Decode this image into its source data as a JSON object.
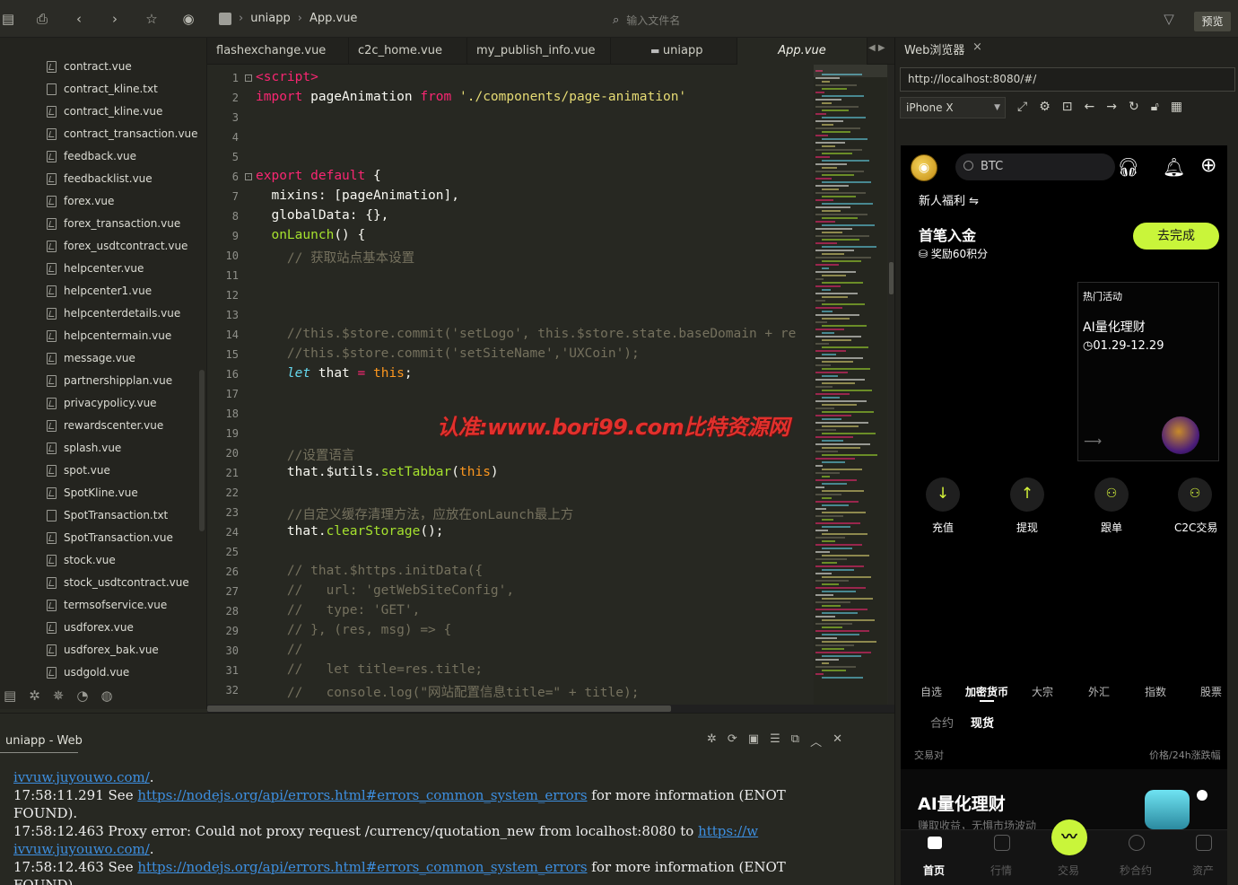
{
  "toolbar": {
    "breadcrumb": [
      "uniapp",
      "App.vue"
    ],
    "file_search_placeholder": "输入文件名",
    "preview_label": "预览",
    "icons": [
      "sidebar-toggle-icon",
      "save-icon",
      "back-arrow-icon",
      "forward-arrow-icon",
      "star-icon",
      "run-icon",
      "filter-icon"
    ]
  },
  "sidebar": {
    "files": [
      {
        "name": "contract.vue",
        "type": "vue"
      },
      {
        "name": "contract_kline.txt",
        "type": "txt"
      },
      {
        "name": "contract_kline.vue",
        "type": "vue"
      },
      {
        "name": "contract_transaction.vue",
        "type": "vue"
      },
      {
        "name": "feedback.vue",
        "type": "vue"
      },
      {
        "name": "feedbacklist.vue",
        "type": "vue"
      },
      {
        "name": "forex.vue",
        "type": "vue"
      },
      {
        "name": "forex_transaction.vue",
        "type": "vue"
      },
      {
        "name": "forex_usdtcontract.vue",
        "type": "vue"
      },
      {
        "name": "helpcenter.vue",
        "type": "vue"
      },
      {
        "name": "helpcenter1.vue",
        "type": "vue"
      },
      {
        "name": "helpcenterdetails.vue",
        "type": "vue"
      },
      {
        "name": "helpcentermain.vue",
        "type": "vue"
      },
      {
        "name": "message.vue",
        "type": "vue"
      },
      {
        "name": "partnershipplan.vue",
        "type": "vue"
      },
      {
        "name": "privacypolicy.vue",
        "type": "vue"
      },
      {
        "name": "rewardscenter.vue",
        "type": "vue"
      },
      {
        "name": "splash.vue",
        "type": "vue"
      },
      {
        "name": "spot.vue",
        "type": "vue"
      },
      {
        "name": "SpotKline.vue",
        "type": "vue"
      },
      {
        "name": "SpotTransaction.txt",
        "type": "txt"
      },
      {
        "name": "SpotTransaction.vue",
        "type": "vue"
      },
      {
        "name": "stock.vue",
        "type": "vue"
      },
      {
        "name": "stock_usdtcontract.vue",
        "type": "vue"
      },
      {
        "name": "termsofservice.vue",
        "type": "vue"
      },
      {
        "name": "usdforex.vue",
        "type": "vue"
      },
      {
        "name": "usdforex_bak.vue",
        "type": "vue"
      },
      {
        "name": "usdgold.vue",
        "type": "vue"
      }
    ]
  },
  "tabs": [
    {
      "label": "flashexchange.vue",
      "active": false
    },
    {
      "label": "c2c_home.vue",
      "active": false
    },
    {
      "label": "my_publish_info.vue",
      "active": false
    },
    {
      "label": "uniapp",
      "active": false,
      "folder": true
    },
    {
      "label": "App.vue",
      "active": true
    }
  ],
  "editor": {
    "lines": [
      {
        "n": "1",
        "fold": "⊟",
        "code": [
          [
            "kw",
            "<script>"
          ]
        ]
      },
      {
        "n": "2",
        "code": [
          [
            "kw",
            "import"
          ],
          [
            "pr",
            " pageAnimation "
          ],
          [
            "kw",
            "from"
          ],
          [
            "pr",
            " "
          ],
          [
            "str",
            "'./components/page-animation'"
          ]
        ]
      },
      {
        "n": "3",
        "code": []
      },
      {
        "n": "4",
        "code": []
      },
      {
        "n": "5",
        "code": []
      },
      {
        "n": "6",
        "fold": "⊟",
        "code": [
          [
            "kw",
            "export"
          ],
          [
            "pr",
            " "
          ],
          [
            "kw",
            "default"
          ],
          [
            "pr",
            " {"
          ]
        ]
      },
      {
        "n": "7",
        "code": [
          [
            "pr",
            "  mixins: [pageAnimation],"
          ]
        ]
      },
      {
        "n": "8",
        "code": [
          [
            "pr",
            "  globalData: {},"
          ]
        ]
      },
      {
        "n": "9",
        "code": [
          [
            "pr",
            "  "
          ],
          [
            "fn",
            "onLaunch"
          ],
          [
            "pr",
            "() {"
          ]
        ]
      },
      {
        "n": "10",
        "code": [
          [
            "cm",
            "    // 获取站点基本设置"
          ]
        ]
      },
      {
        "n": "11",
        "code": []
      },
      {
        "n": "12",
        "code": []
      },
      {
        "n": "13",
        "code": []
      },
      {
        "n": "14",
        "code": [
          [
            "cm",
            "    //this.$store.commit('setLogo', this.$store.state.baseDomain + re"
          ]
        ]
      },
      {
        "n": "15",
        "code": [
          [
            "cm",
            "    //this.$store.commit('setSiteName','UXCoin');"
          ]
        ]
      },
      {
        "n": "16",
        "code": [
          [
            "pr",
            "    "
          ],
          [
            "it",
            "let"
          ],
          [
            "pr",
            " that "
          ],
          [
            "kw",
            "="
          ],
          [
            "pr",
            " "
          ],
          [
            "num",
            "this"
          ],
          [
            "pr",
            ";"
          ]
        ]
      },
      {
        "n": "17",
        "code": []
      },
      {
        "n": "18",
        "code": []
      },
      {
        "n": "19",
        "code": []
      },
      {
        "n": "20",
        "code": [
          [
            "cm",
            "    //设置语言"
          ]
        ]
      },
      {
        "n": "21",
        "code": [
          [
            "pr",
            "    that.$utils."
          ],
          [
            "fn",
            "setTabbar"
          ],
          [
            "pr",
            "("
          ],
          [
            "num",
            "this"
          ],
          [
            "pr",
            ")"
          ]
        ]
      },
      {
        "n": "22",
        "code": []
      },
      {
        "n": "23",
        "code": [
          [
            "cm",
            "    //自定义缓存清理方法，应放在onLaunch最上方"
          ]
        ]
      },
      {
        "n": "24",
        "code": [
          [
            "pr",
            "    that."
          ],
          [
            "fn",
            "clearStorage"
          ],
          [
            "pr",
            "();"
          ]
        ]
      },
      {
        "n": "25",
        "code": []
      },
      {
        "n": "26",
        "code": [
          [
            "cm",
            "    // that.$https.initData({"
          ]
        ]
      },
      {
        "n": "27",
        "code": [
          [
            "cm",
            "    //   url: 'getWebSiteConfig',"
          ]
        ]
      },
      {
        "n": "28",
        "code": [
          [
            "cm",
            "    //   type: 'GET',"
          ]
        ]
      },
      {
        "n": "29",
        "code": [
          [
            "cm",
            "    // }, (res, msg) => {"
          ]
        ]
      },
      {
        "n": "30",
        "code": [
          [
            "cm",
            "    //"
          ]
        ]
      },
      {
        "n": "31",
        "code": [
          [
            "cm",
            "    //   let title=res.title;"
          ]
        ]
      },
      {
        "n": "32",
        "code": [
          [
            "cm",
            "    //   console.log(\"网站配置信息title=\" + title);"
          ]
        ]
      }
    ]
  },
  "watermark": "认准:www.bori99.com比特资源网",
  "console": {
    "tab": "uniapp - Web",
    "lines": [
      [
        {
          "t": "link",
          "v": "ivvuw.juyouwo.com/"
        },
        {
          "t": "text",
          "v": "."
        }
      ],
      [
        {
          "t": "text",
          "v": "17:58:11.291 See "
        },
        {
          "t": "link",
          "v": "https://nodejs.org/api/errors.html#errors_common_system_errors"
        },
        {
          "t": "text",
          "v": " for more information (ENOT"
        }
      ],
      [
        {
          "t": "text",
          "v": "FOUND)."
        }
      ],
      [
        {
          "t": "text",
          "v": "17:58:12.463 Proxy error: Could not proxy request /currency/quotation_new from localhost:8080 to "
        },
        {
          "t": "link",
          "v": "https://w"
        }
      ],
      [
        {
          "t": "link",
          "v": "ivvuw.juyouwo.com/"
        },
        {
          "t": "text",
          "v": "."
        }
      ],
      [
        {
          "t": "text",
          "v": "17:58:12.463 See "
        },
        {
          "t": "link",
          "v": "https://nodejs.org/api/errors.html#errors_common_system_errors"
        },
        {
          "t": "text",
          "v": " for more information (ENOT"
        }
      ],
      [
        {
          "t": "text",
          "v": "FOUND)."
        }
      ]
    ]
  },
  "browser": {
    "tab_title": "Web浏览器",
    "close": "×",
    "url": "http://localhost:8080/#/",
    "device": "iPhone X"
  },
  "phone": {
    "search_placeholder": "BTC",
    "newbie_label": "新人福利 ⇋",
    "first_deposit_title": "首笔入金",
    "reward_text": "奖励60积分",
    "go_button": "去完成",
    "hot_title": "热门活动",
    "hot_item_title": "AI量化理财",
    "hot_item_date": "01.29-12.29",
    "actions": [
      "充值",
      "提现",
      "跟单",
      "C2C交易"
    ],
    "market_tabs": [
      "自选",
      "加密货币",
      "大宗",
      "外汇",
      "指数",
      "股票"
    ],
    "market_tabs_active": "加密货币",
    "sub_tabs": [
      "合约",
      "现货"
    ],
    "sub_tabs_active": "现货",
    "list_head_left": "交易对",
    "list_head_right": "价格/24h涨跌幅",
    "promo_title": "AI量化理财",
    "promo_sub": "赚取收益，无惧市场波动",
    "nav": [
      "首页",
      "行情",
      "交易",
      "秒合约",
      "资产"
    ],
    "accent_color": "#c9f53a"
  }
}
